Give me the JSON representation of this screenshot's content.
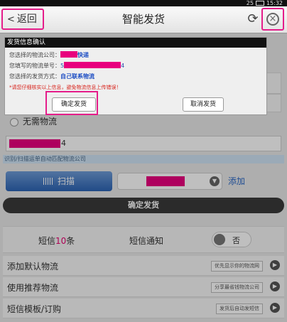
{
  "status_bar": {
    "battery": "25",
    "time": "15:32"
  },
  "header": {
    "back_label": "返回",
    "title": "智能发货",
    "refresh_icon": "refresh-icon",
    "close_icon": "close-circle-icon"
  },
  "form": {
    "no_logistics_label": "无需物流",
    "tracking_suffix": "4",
    "hint": "识别/扫描运单自动匹配物流公司",
    "scan_label": "扫描",
    "add_label": "添加",
    "confirm_label": "确定发货"
  },
  "sms": {
    "count_prefix": "短信",
    "count_num": "10",
    "count_suffix": "条",
    "notify_label": "短信通知",
    "toggle_label": "否"
  },
  "list": [
    {
      "label": "添加默认物流",
      "tag": "优先显示你的物流网"
    },
    {
      "label": "使用推荐物流",
      "tag": "分享最省钱物流公司"
    },
    {
      "label": "短信模板/订购",
      "tag": "发货后自动发短信"
    }
  ],
  "dialog": {
    "title": "发货信息确认",
    "line1_label": "您选择的物流公司：",
    "line1_value": "快递",
    "line2_label": "您填写的物流单号：",
    "line2_value_start": "5",
    "line2_value_end": "4",
    "line3_label": "您选择的发货方式：",
    "line3_value": "自己联系物流",
    "warning": "*请您仔细核实以上信息，避免物流信息上传错误！",
    "confirm_button": "确定发货",
    "cancel_button": "取消发货"
  },
  "colors": {
    "highlight": "#e51d8a",
    "redaction": "#e8007e",
    "accent": "#2a67c4"
  }
}
